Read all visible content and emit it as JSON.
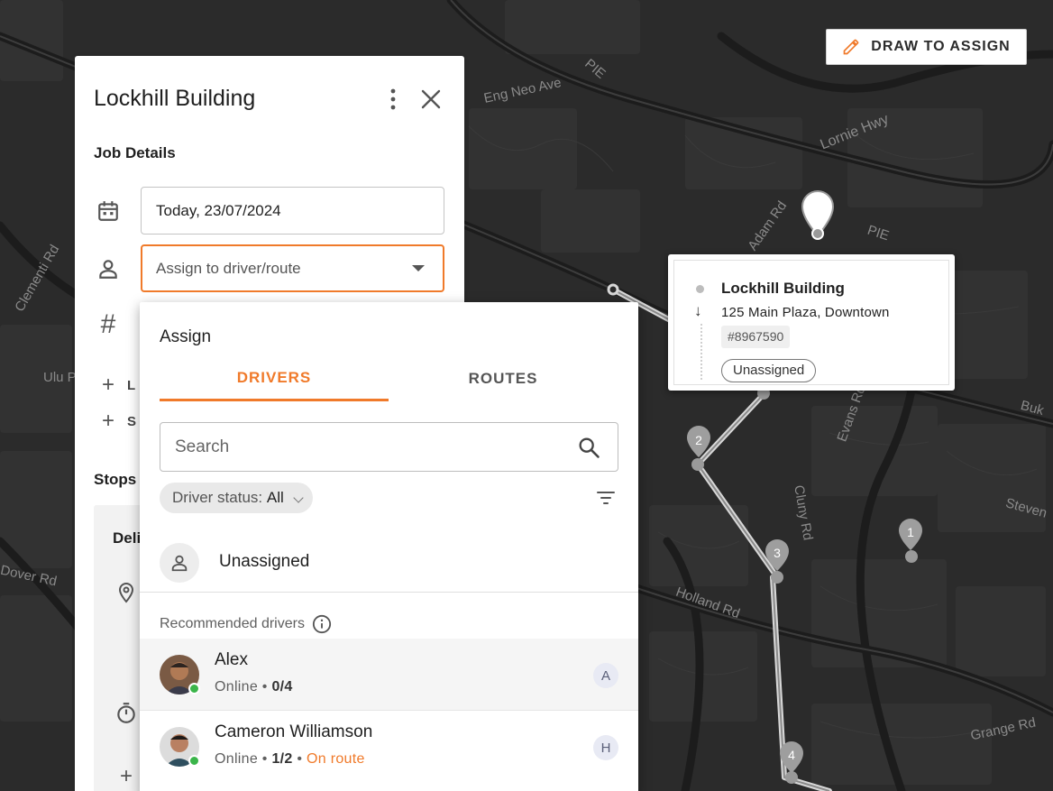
{
  "map": {
    "roads": [
      "Eng Neo Ave",
      "PIE",
      "Lornie Hwy",
      "Adam Rd",
      "PIE",
      "Holland Rd",
      "Cluny Rd",
      "Evans Rd",
      "Grange Rd",
      "Steven",
      "Buk",
      "Clementi Rd",
      "Ulu P",
      "Dover Rd"
    ],
    "markers": [
      "1",
      "2",
      "3",
      "4"
    ],
    "draw_button": "DRAW TO ASSIGN"
  },
  "popup": {
    "title": "Lockhill Building",
    "address": "125 Main Plaza, Downtown",
    "id": "#8967590",
    "status": "Unassigned"
  },
  "panel": {
    "title": "Lockhill Building",
    "section": "Job Details",
    "date": "Today, 23/07/2024",
    "assign_placeholder": "Assign to driver/route",
    "hash_symbol": "#",
    "side_items": [
      "L",
      "S"
    ],
    "stops_label": "Stops",
    "stops_card_label": "Deli"
  },
  "assign": {
    "heading": "Assign",
    "tabs": [
      "DRIVERS",
      "ROUTES"
    ],
    "search_placeholder": "Search",
    "chip_label": "Driver status:",
    "chip_value": "All",
    "unassigned_label": "Unassigned",
    "recommended_label": "Recommended drivers",
    "drivers": [
      {
        "name": "Alex",
        "status": "Online",
        "load": "0/4",
        "extra": "",
        "initial": "A"
      },
      {
        "name": "Cameron Williamson",
        "status": "Online",
        "load": "1/2",
        "extra": "On route",
        "initial": "H"
      }
    ]
  },
  "colors": {
    "accent": "#f07a2a",
    "online": "#3bb54a",
    "map_bg": "#2a2a2a"
  }
}
